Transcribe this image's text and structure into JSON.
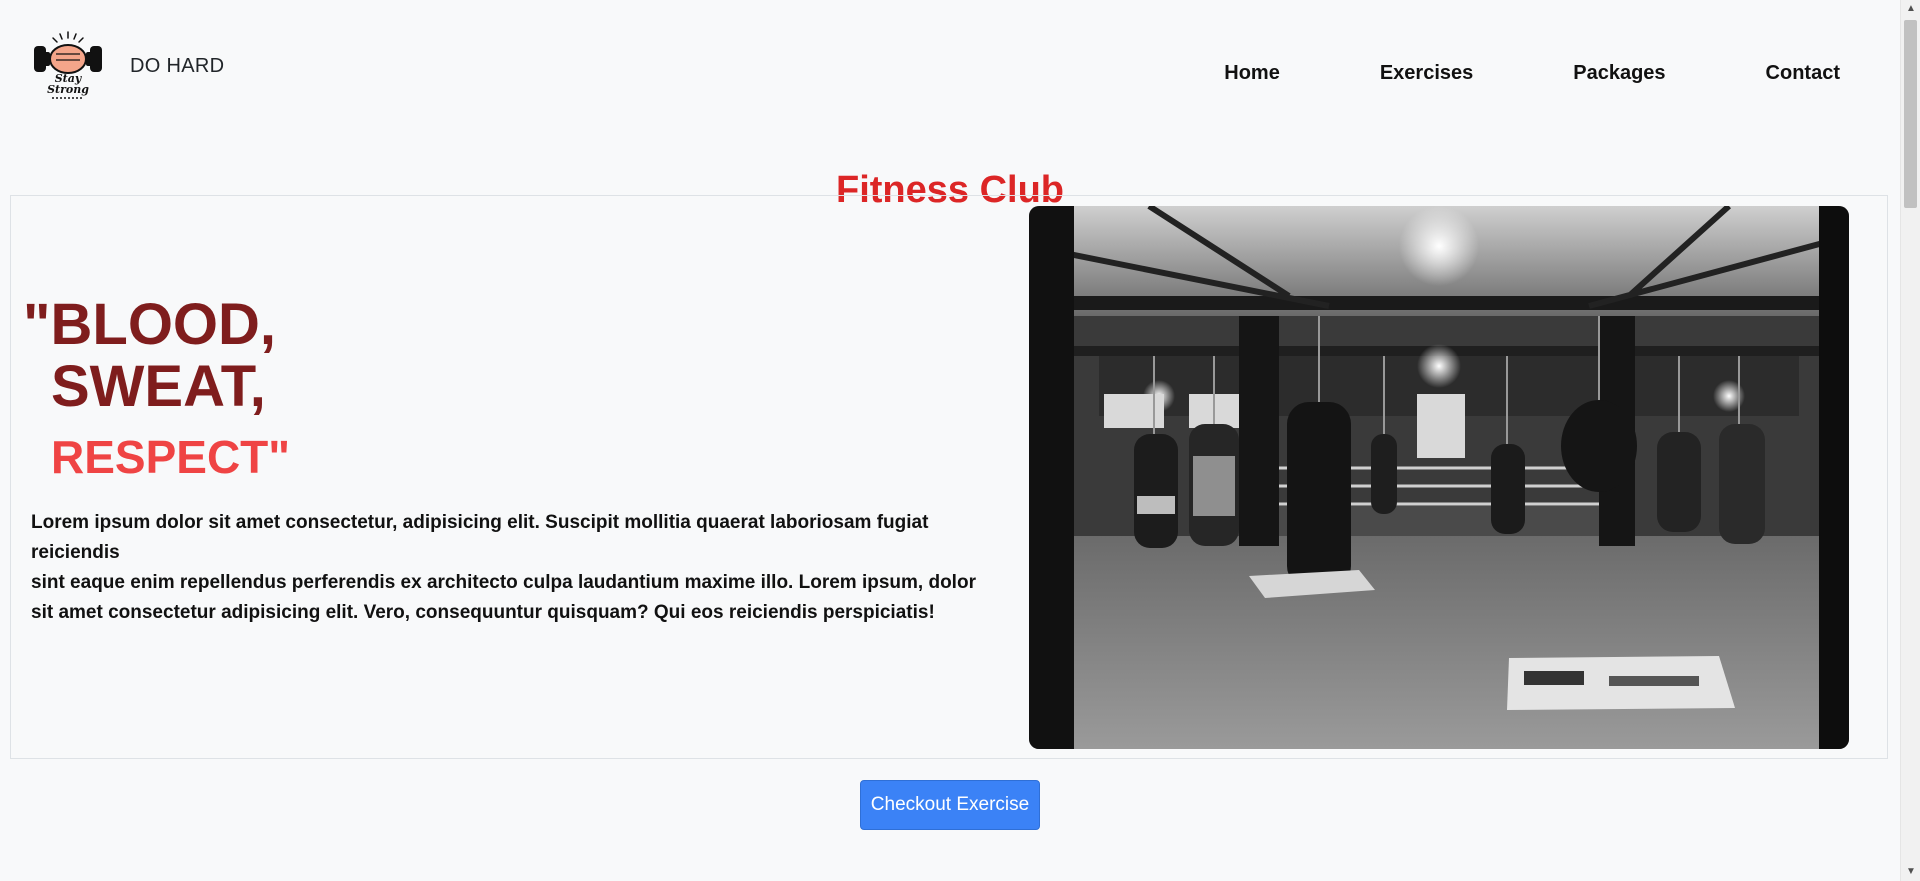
{
  "brand": {
    "logo_icon": "stay-strong-fist-logo",
    "logo_text_top": "Stay",
    "logo_text_bottom": "Strong",
    "name": "DO HARD"
  },
  "nav": {
    "items": [
      {
        "label": "Home"
      },
      {
        "label": "Exercises"
      },
      {
        "label": "Packages"
      },
      {
        "label": "Contact"
      }
    ]
  },
  "hero": {
    "title": "Fitness Club",
    "quote_line1": "\"BLOOD,",
    "quote_line2": "SWEAT,",
    "quote_line3": "RESPECT\"",
    "paragraph_line1": "Lorem ipsum dolor sit amet consectetur, adipisicing elit. Suscipit mollitia quaerat laboriosam fugiat reiciendis",
    "paragraph_line2": "sint eaque enim repellendus perferendis ex architecto culpa laudantium maxime illo. Lorem ipsum, dolor sit amet consectetur adipisicing elit. Vero, consequuntur quisquam? Qui eos reiciendis perspiciatis!",
    "image_icon": "boxing-gym-photo"
  },
  "cta": {
    "label": "Checkout Exercise"
  },
  "colors": {
    "title": "#dc2626",
    "quote_dark": "#7f1d1d",
    "quote_light": "#ef4444",
    "button": "#3b82f6",
    "background": "#f8f9fa"
  }
}
